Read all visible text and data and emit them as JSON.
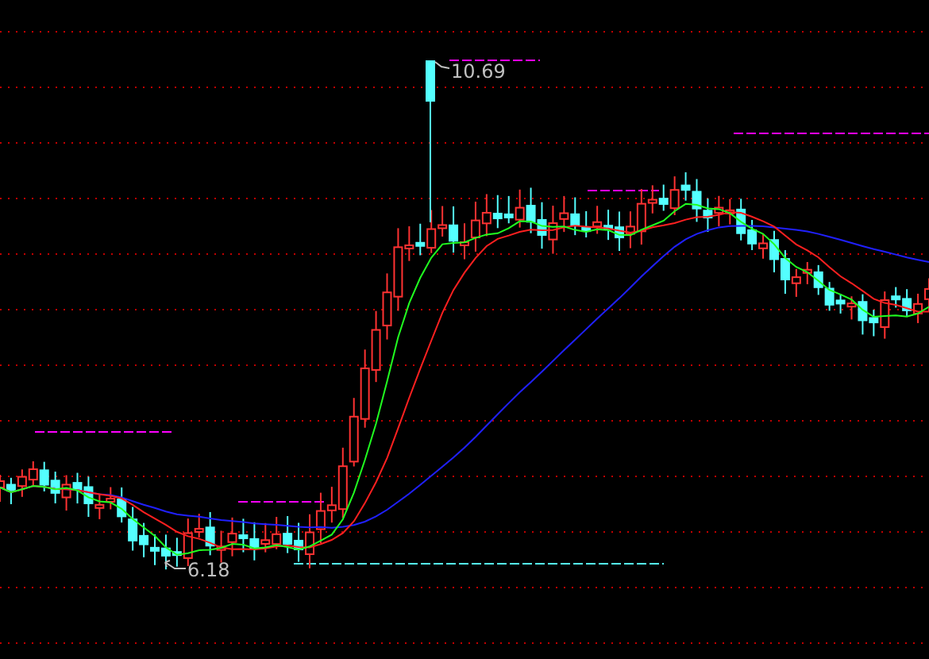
{
  "chart": {
    "high_label": "10.69",
    "low_label": "6.18"
  }
}
